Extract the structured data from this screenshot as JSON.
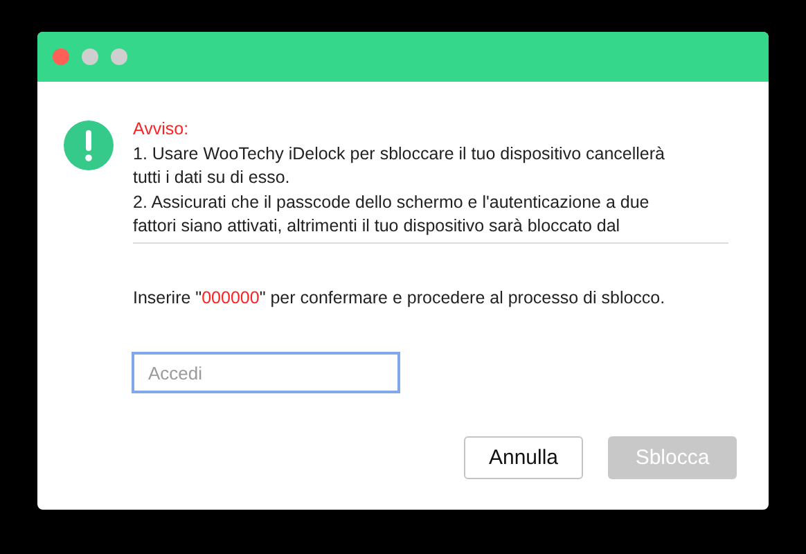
{
  "window": {
    "traffic_lights": [
      {
        "kind": "close"
      },
      {
        "kind": "minimize"
      },
      {
        "kind": "zoom"
      }
    ]
  },
  "warning": {
    "title": "Avviso:",
    "items": [
      "1. Usare WooTechy iDelock per sbloccare il tuo dispositivo cancellerà tutti i dati su di esso.",
      "2. Assicurati che il passcode dello schermo e l'autenticazione a due fattori siano attivati, altrimenti il tuo dispositivo sarà bloccato dal"
    ]
  },
  "instruction": {
    "before": "Inserire \"",
    "code": "000000",
    "after": "\" per confermare e procedere al processo di sblocco."
  },
  "input": {
    "placeholder": "Accedi",
    "focused": true
  },
  "buttons": [
    {
      "label": "Annulla",
      "disabled": false
    },
    {
      "label": "Sblocca",
      "disabled": true
    }
  ]
}
